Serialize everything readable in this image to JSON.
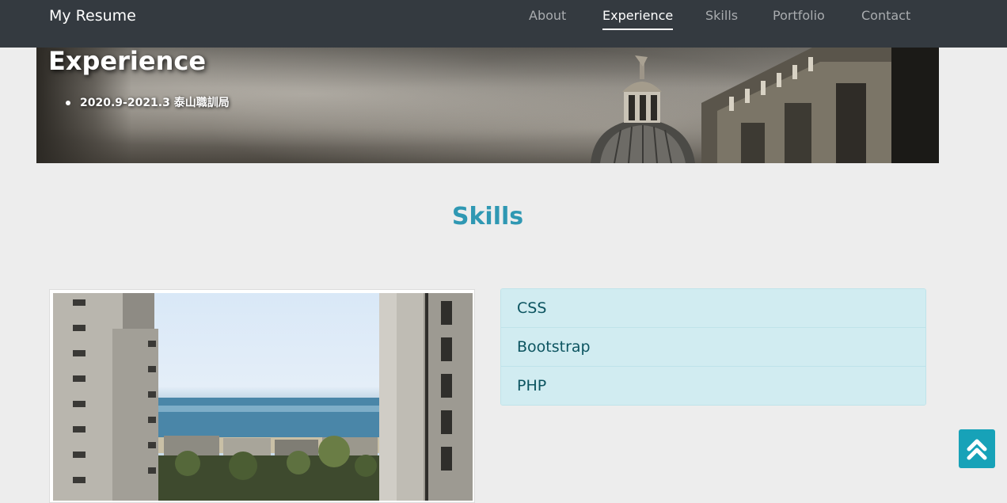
{
  "navbar": {
    "brand": "My Resume",
    "links": [
      {
        "label": "About",
        "active": false
      },
      {
        "label": "Experience",
        "active": true
      },
      {
        "label": "Skills",
        "active": false
      },
      {
        "label": "Portfolio",
        "active": false
      },
      {
        "label": "Contact",
        "active": false
      }
    ]
  },
  "experience": {
    "title": "Experience",
    "items": [
      "2020.9-2021.3 泰山職訓局"
    ]
  },
  "skills": {
    "title": "Skills",
    "items": [
      "CSS",
      "Bootstrap",
      "PHP"
    ]
  },
  "back_to_top": {
    "icon": "double-chevron-up-icon"
  },
  "colors": {
    "navbar_bg": "#343a40",
    "accent": "#2f98b3",
    "list_bg": "#d1ecf1",
    "list_text": "#0c5460",
    "button_bg": "#17a2b8",
    "page_bg": "#ededed"
  }
}
